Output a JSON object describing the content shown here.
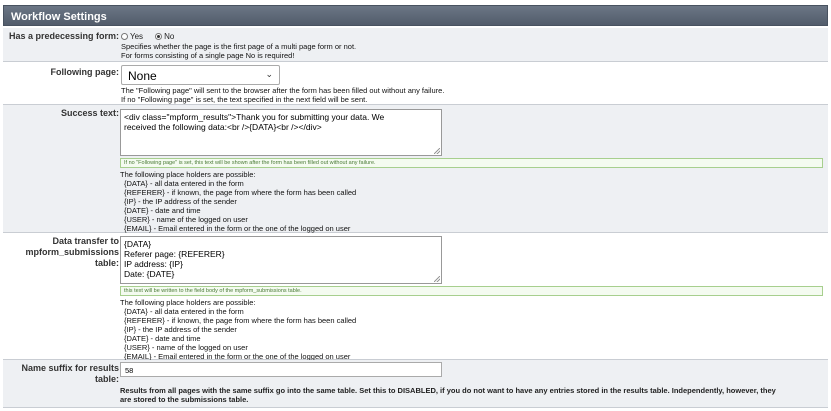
{
  "header": {
    "title": "Workflow Settings"
  },
  "predecessing": {
    "label": "Has a predecessing form:",
    "options": [
      {
        "label": "Yes",
        "selected": false
      },
      {
        "label": "No",
        "selected": true
      }
    ],
    "desc": [
      "Specifies whether the page is the first page of a multi page form or not.",
      "For forms consisting of a single page No is required!"
    ]
  },
  "following": {
    "label": "Following page:",
    "value": "None",
    "desc": [
      "The \"Following page\" will sent to the browser after the form has been filled out without any failure.",
      "If no \"Following page\" is set, the text specified in the next field will be sent."
    ]
  },
  "success": {
    "label": "Success text:",
    "lines": [
      "<div class=\"mpform_results\">Thank you for submitting your data. We",
      "received the following data:<br />{DATA}<br /></div>"
    ],
    "hint": "If no \"Following page\" is set, this text will be shown after the form has been filled out without any failure.",
    "placeholders": [
      "The following place holders are possible:",
      "  {DATA} - all data entered in the form",
      "  {REFERER} - if known, the page from where the form has been called",
      "  {IP} - the IP address of the sender",
      "  {DATE} - date and time",
      "  {USER} - name of the logged on user",
      "  {EMAIL} - Email entered in the form or the one of the logged on user"
    ]
  },
  "transfer": {
    "label": "Data transfer to mpform_submissions table:",
    "lines": [
      "{DATA}",
      "Referer page: {REFERER}",
      "IP address: {IP}",
      "Date: {DATE}"
    ],
    "hint": "this text will be written to the field body of the mpform_submissions table.",
    "placeholders": [
      "The following place holders are possible:",
      "  {DATA} - all data entered in the form",
      "  {REFERER} - if known, the page from where the form has been called",
      "  {IP} - the IP address of the sender",
      "  {DATE} - date and time",
      "  {USER} - name of the logged on user",
      "  {EMAIL} - Email entered in the form or the one of the logged on user"
    ]
  },
  "suffix": {
    "label": "Name suffix for results table:",
    "value": "58",
    "desc": [
      "Results from all pages with the same suffix go into the same table. Set this to DISABLED, if you do not want to have any entries stored in the results table. Independently, however, they",
      "are stored to the submissions table."
    ]
  }
}
